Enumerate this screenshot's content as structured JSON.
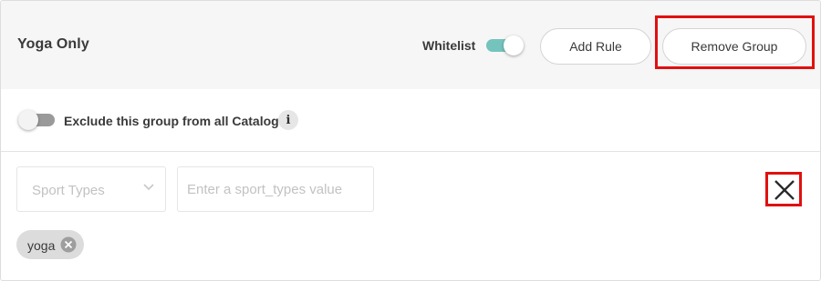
{
  "group": {
    "title": "Yoga Only",
    "whitelist_label": "Whitelist",
    "whitelist_enabled": true,
    "add_rule_label": "Add Rule",
    "remove_group_label": "Remove Group"
  },
  "exclude": {
    "label": "Exclude this group from all Catalogs",
    "enabled": false,
    "info_icon": "i"
  },
  "rule": {
    "field_placeholder": "Sport Types",
    "value_placeholder": "Enter a sport_types value",
    "close_icon": "close-icon"
  },
  "tags": [
    {
      "label": "yoga"
    }
  ],
  "colors": {
    "toggle_on": "#75c3bd",
    "toggle_off": "#9a9a9a",
    "highlight": "#e01010",
    "header_bg": "#f6f6f6",
    "tag_bg": "#dcdcdc"
  }
}
